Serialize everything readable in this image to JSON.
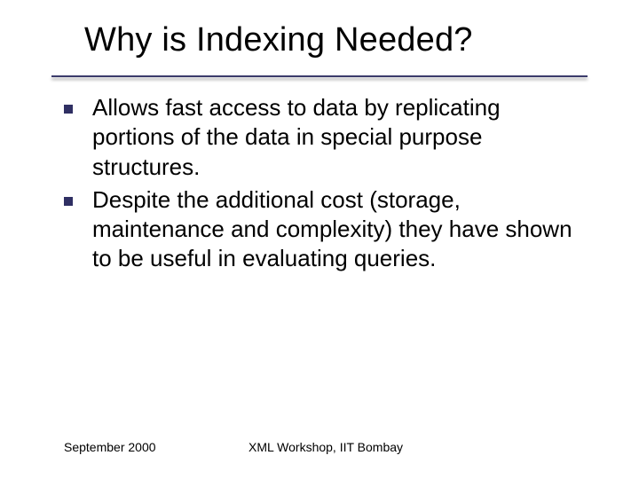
{
  "slide": {
    "title": "Why is Indexing Needed?",
    "bullets": [
      "Allows fast access to data by replicating portions of the data in special purpose structures.",
      "Despite the additional cost (storage, maintenance and complexity) they have shown to be useful in evaluating queries."
    ],
    "footer": {
      "left": "September 2000",
      "center": "XML Workshop, IIT Bombay"
    }
  }
}
